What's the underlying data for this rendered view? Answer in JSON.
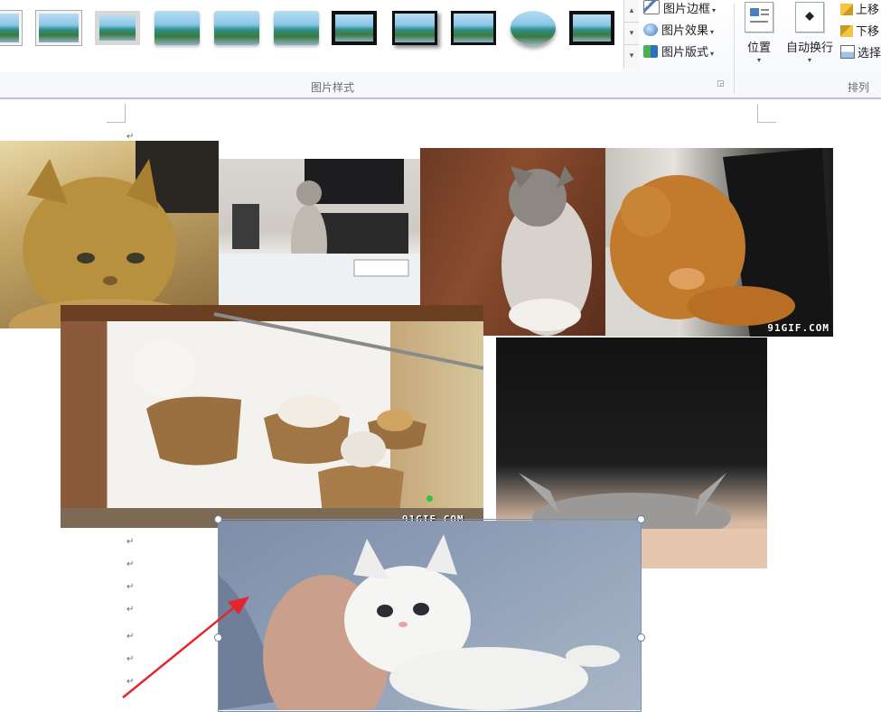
{
  "ribbon": {
    "picture_styles_group_label": "图片样式",
    "arrange_group_label": "排列",
    "styles": [
      {
        "name": "style-simple-frame"
      },
      {
        "name": "style-frame-white"
      },
      {
        "name": "style-frame-gray"
      },
      {
        "name": "style-soft-edge"
      },
      {
        "name": "style-reflected"
      },
      {
        "name": "style-soft-rounded"
      },
      {
        "name": "style-thick-black"
      },
      {
        "name": "style-black-shadow"
      },
      {
        "name": "style-thin-black"
      },
      {
        "name": "style-oval"
      },
      {
        "name": "style-black-matte"
      }
    ],
    "scroll_up": "▴",
    "scroll_down": "▾",
    "scroll_more": "▾",
    "picture_border_label": "图片边框",
    "picture_effects_label": "图片效果",
    "picture_layout_label": "图片版式",
    "position_label": "位置",
    "wrap_text_label": "自动换行",
    "bring_forward_label": "上移",
    "send_backward_label": "下移",
    "selection_pane_label": "选择"
  },
  "document": {
    "watermark_1": "91GIF.COM",
    "watermark_2": "91GIF.COM",
    "paragraph_mark": "↵"
  }
}
